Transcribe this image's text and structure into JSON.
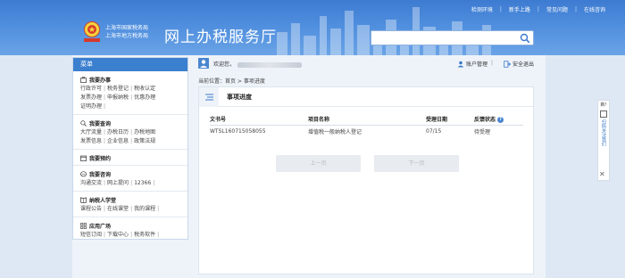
{
  "top_nav": {
    "links": [
      "检测环境",
      "新手上路",
      "常见问题",
      "在线咨询"
    ]
  },
  "header": {
    "emblem_text": "中国税务",
    "bureau_line1": "上海市国家税务局",
    "bureau_line2": "上海市地方税务局",
    "site_title": "网上办税服务厅",
    "search": {
      "value": "",
      "placeholder": ""
    }
  },
  "userbar": {
    "welcome": "欢迎您，",
    "account": "账户管理",
    "divider": "|",
    "logout": "安全退出"
  },
  "breadcrumb": "当前位置：首页 > 事项进度",
  "sidebar": {
    "header": "菜单",
    "sections": [
      {
        "title": "我要办事",
        "icon": "briefcase-icon",
        "rows": [
          [
            "行政许可",
            "税务登记",
            "税收认定"
          ],
          [
            "发票办理",
            "申报纳税",
            "优惠办理"
          ],
          [
            "证明办理"
          ]
        ]
      },
      {
        "title": "我要查询",
        "icon": "magnifier-icon",
        "rows": [
          [
            "大厅流量",
            "办税日历",
            "办税地图"
          ],
          [
            "发票信息",
            "企业信息",
            "政策法规"
          ]
        ]
      },
      {
        "title": "我要预约",
        "icon": "calendar-icon",
        "rows": []
      },
      {
        "title": "我要咨询",
        "icon": "chat-icon",
        "rows": [
          [
            "沟通交流",
            "网上提问",
            "12366"
          ]
        ]
      },
      {
        "title": "纳税人学堂",
        "icon": "book-icon",
        "rows": [
          [
            "课程公告",
            "在线课堂",
            "我的课程"
          ]
        ]
      },
      {
        "title": "应用广场",
        "icon": "grid-icon",
        "rows": [
          [
            "短信订阅",
            "下载中心",
            "税务软件"
          ]
        ]
      }
    ]
  },
  "panel": {
    "title": "事项进度",
    "columns": [
      "文书号",
      "项目名称",
      "受理日期",
      "反馈状态"
    ],
    "rows": [
      {
        "doc_no": "WTSL160715058055",
        "item": "增值税一般纳税人登记",
        "date": "07/15",
        "status": "待受理"
      }
    ],
    "prev": "上一页",
    "next": "下一页"
  },
  "float_tab": {
    "new_label": "新!",
    "vertical_text": "扫码关注我们",
    "close": "✕"
  },
  "colors": {
    "header_blue": "#4f8ede",
    "sidebar_head": "#3b7fcf",
    "link_blue": "#3a78c9"
  }
}
